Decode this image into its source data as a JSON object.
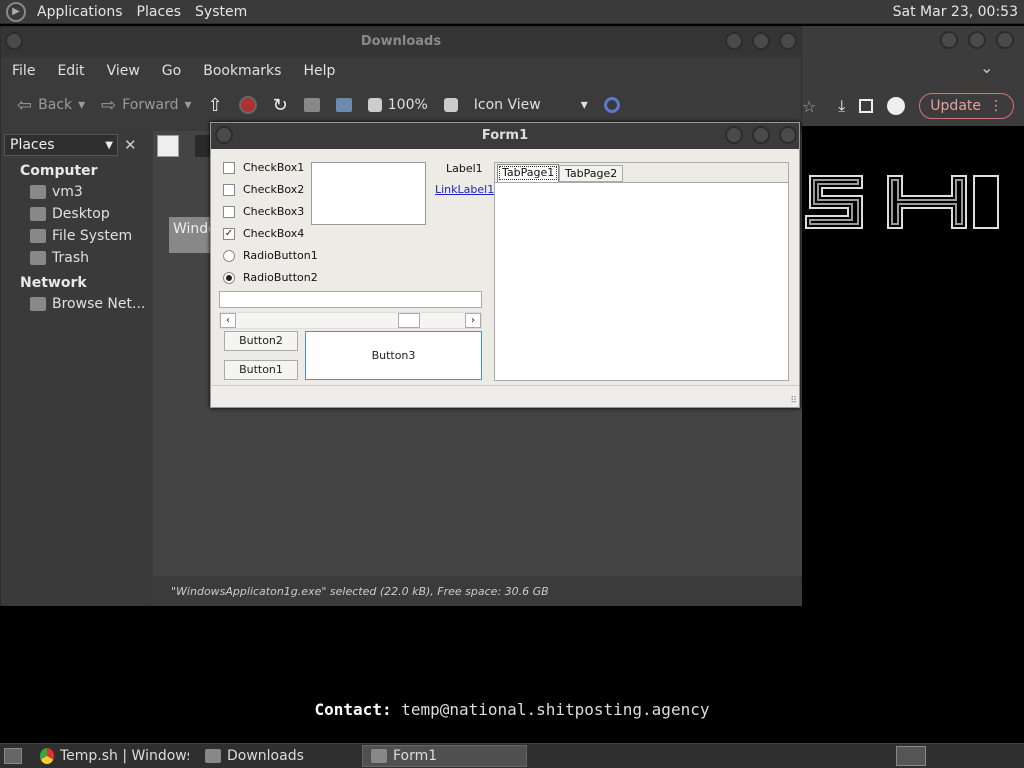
{
  "topbar": {
    "menus": [
      "Applications",
      "Places",
      "System"
    ],
    "clock": "Sat Mar 23, 00:53"
  },
  "file_manager": {
    "title": "Downloads",
    "menus": [
      "File",
      "Edit",
      "View",
      "Go",
      "Bookmarks",
      "Help"
    ],
    "toolbar": {
      "back": "Back",
      "forward": "Forward",
      "zoom": "100%",
      "view_mode": "Icon View"
    },
    "sidebar": {
      "combo": "Places",
      "sections": [
        {
          "title": "Computer",
          "items": [
            "vm3",
            "Desktop",
            "File System",
            "Trash"
          ]
        },
        {
          "title": "Network",
          "items": [
            "Browse Net..."
          ]
        }
      ]
    },
    "main_item": "Windo",
    "status": "\"WindowsApplicaton1g.exe\" selected (22.0 kB), Free space: 30.6 GB"
  },
  "browser": {
    "update_label": "Update"
  },
  "contact": {
    "label": "Contact:",
    "value": "temp@national.shitposting.agency"
  },
  "form1": {
    "title": "Form1",
    "checkboxes": [
      {
        "label": "CheckBox1",
        "checked": false
      },
      {
        "label": "CheckBox2",
        "checked": false
      },
      {
        "label": "CheckBox3",
        "checked": false
      },
      {
        "label": "CheckBox4",
        "checked": true
      }
    ],
    "radios": [
      {
        "label": "RadioButton1",
        "checked": false
      },
      {
        "label": "RadioButton2",
        "checked": true
      }
    ],
    "label1": "Label1",
    "linklabel1": "LinkLabel1",
    "tabs": [
      "TabPage1",
      "TabPage2"
    ],
    "buttons": {
      "button1": "Button1",
      "button2": "Button2",
      "button3": "Button3"
    }
  },
  "taskbar": {
    "items": [
      "Temp.sh | Windows...",
      "Downloads",
      "Form1"
    ]
  }
}
